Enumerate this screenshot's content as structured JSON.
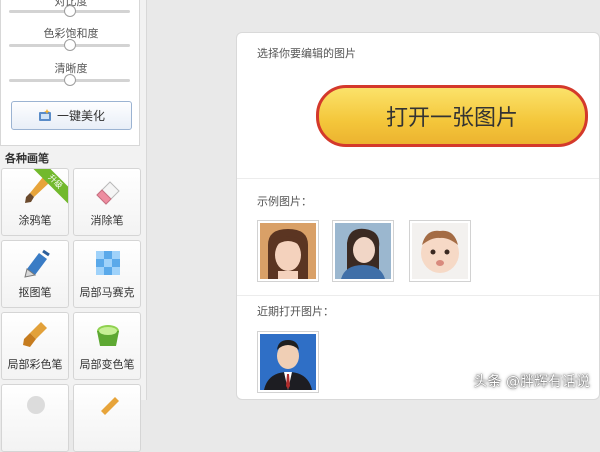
{
  "adjustments": {
    "brightness": {
      "label": "对比度",
      "level": 0.5
    },
    "saturation": {
      "label": "色彩饱和度",
      "level": 0.5
    },
    "sharpness": {
      "label": "清晰度",
      "level": 0.5
    },
    "beautify_label": "一键美化"
  },
  "brushes": {
    "title": "各种画笔",
    "items": [
      {
        "label": "涂鸦笔",
        "icon": "paintbrush-icon",
        "badge": "升级"
      },
      {
        "label": "消除笔",
        "icon": "eraser-icon"
      },
      {
        "label": "抠图笔",
        "icon": "pen-nib-icon"
      },
      {
        "label": "局部马赛克",
        "icon": "mosaic-icon"
      },
      {
        "label": "局部彩色笔",
        "icon": "color-brush-icon"
      },
      {
        "label": "局部变色笔",
        "icon": "color-bucket-icon"
      }
    ]
  },
  "main": {
    "choose_label": "选择你要编辑的图片",
    "open_button": "打开一张图片",
    "sample_label": "示例图片：",
    "samples": [
      {
        "icon": "woman-bangs-photo"
      },
      {
        "icon": "woman-selfie-photo"
      },
      {
        "icon": "baby-photo"
      }
    ],
    "recent_label": "近期打开图片：",
    "recent": [
      {
        "icon": "man-suit-photo"
      }
    ]
  },
  "watermark": "头条 @胖辉有话说",
  "colors": {
    "open_button_border": "#d4392b",
    "open_button_fill": "#f4c63a",
    "badge": "#72b92d"
  }
}
